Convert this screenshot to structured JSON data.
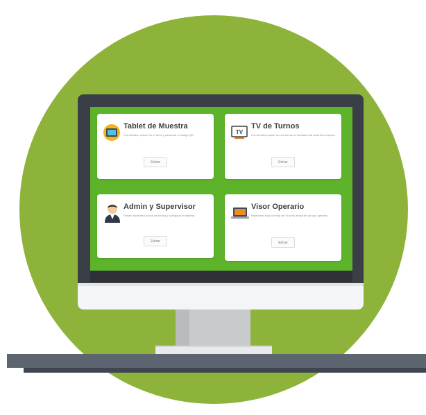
{
  "cards": [
    {
      "title": "Tablet de Muestra",
      "description": "Los clientes podrán ver el turno y escanear el código QR.",
      "button": "Entrar",
      "icon": "tablet-icon"
    },
    {
      "title": "TV de Turnos",
      "description": "Los clientes podrán ver los turnos en llamada real durante la espera.",
      "button": "Entrar",
      "icon": "tv-icon",
      "icon_text": "TV"
    },
    {
      "title": "Admin y Supervisor",
      "description": "Puede monitorear todos los turnos y configurar el sistema.",
      "button": "Entrar",
      "icon": "admin-avatar-icon"
    },
    {
      "title": "Visor Operario",
      "description": "Para tener solo por rmp ver el turno actual de un solo operario.",
      "button": "Entrar",
      "icon": "laptop-icon"
    }
  ],
  "colors": {
    "background_circle": "#8db33a",
    "screen_background": "#5db32a",
    "monitor_bezel": "#3a3f47",
    "desk": "#5d6570"
  }
}
